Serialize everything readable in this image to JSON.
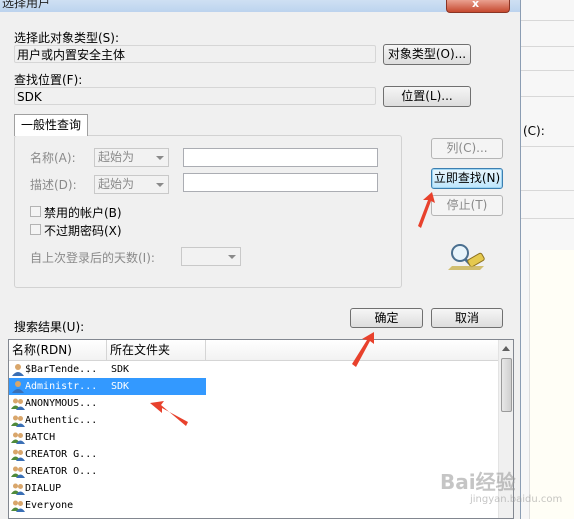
{
  "window": {
    "title": "选择用户",
    "close_glyph": "x"
  },
  "object_type": {
    "label": "选择此对象类型(S):",
    "value": "用户或内置安全主体",
    "button": "对象类型(O)..."
  },
  "location": {
    "label": "查找位置(F):",
    "value": "SDK",
    "button": "位置(L)..."
  },
  "query": {
    "tab": "一般性查询",
    "name_label": "名称(A):",
    "name_op": "起始为",
    "desc_label": "描述(D):",
    "desc_op": "起始为",
    "disabled_accounts": "禁用的帐户(B)",
    "no_expire_pwd": "不过期密码(X)",
    "days_label": "自上次登录后的天数(I):"
  },
  "buttons": {
    "columns": "列(C)...",
    "find_now": "立即查找(N)",
    "stop": "停止(T)",
    "ok": "确定",
    "cancel": "取消"
  },
  "results": {
    "label": "搜索结果(U):",
    "columns": [
      "名称(RDN)",
      "所在文件夹"
    ],
    "rows": [
      {
        "name": "$BarTende...",
        "folder": "SDK",
        "icon": "user-icon"
      },
      {
        "name": "Administr...",
        "folder": "SDK",
        "icon": "user-icon",
        "selected": true
      },
      {
        "name": "ANONYMOUS...",
        "folder": "",
        "icon": "group-icon"
      },
      {
        "name": "Authentic...",
        "folder": "",
        "icon": "group-icon"
      },
      {
        "name": "BATCH",
        "folder": "",
        "icon": "group-icon"
      },
      {
        "name": "CREATOR G...",
        "folder": "",
        "icon": "group-icon"
      },
      {
        "name": "CREATOR O...",
        "folder": "",
        "icon": "group-icon"
      },
      {
        "name": "DIALUP",
        "folder": "",
        "icon": "group-icon"
      },
      {
        "name": "Everyone",
        "folder": "",
        "icon": "group-icon"
      }
    ]
  },
  "background": {
    "label_fragment": "(C):"
  },
  "watermark": {
    "main": "Bai经验",
    "sub": "jingyan.baidu.com"
  },
  "colors": {
    "selection": "#3399ff",
    "arrow": "#e8412c"
  }
}
